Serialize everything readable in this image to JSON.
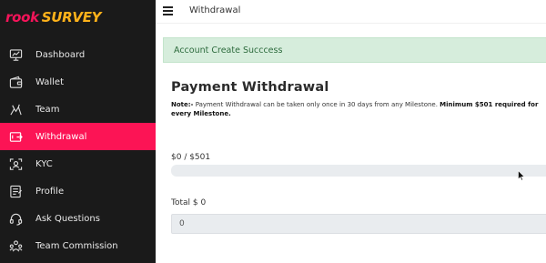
{
  "brand": {
    "rook": "rook",
    "survey": "SURVEY",
    "rook_color": "#f5145a",
    "survey_color": "#ffb21a"
  },
  "sidebar": {
    "items": [
      {
        "label": "Dashboard",
        "icon": "dashboard-icon",
        "active": false
      },
      {
        "label": "Wallet",
        "icon": "wallet-icon",
        "active": false
      },
      {
        "label": "Team",
        "icon": "team-icon",
        "active": false
      },
      {
        "label": "Withdrawal",
        "icon": "withdrawal-icon",
        "active": true
      },
      {
        "label": "KYC",
        "icon": "kyc-icon",
        "active": false
      },
      {
        "label": "Profile",
        "icon": "profile-icon",
        "active": false
      },
      {
        "label": "Ask Questions",
        "icon": "headset-icon",
        "active": false
      },
      {
        "label": "Team Commission",
        "icon": "commission-icon",
        "active": false
      }
    ],
    "active_color": "#fc1455"
  },
  "topbar": {
    "title": "Withdrawal",
    "menu_icon": "hamburger-icon"
  },
  "alert": {
    "message": "Account Create Succcess"
  },
  "main": {
    "title": "Payment Withdrawal",
    "note_prefix": "Note:-",
    "note_text": " Payment Withdrawal can be taken only once in 30 days from any Milestone. ",
    "note_bold": "Minimum $501 required for every Milestone.",
    "progress_label": "$0 / $501",
    "progress_fraction": 0,
    "total_label": "Total $ 0",
    "total_value": "0"
  }
}
